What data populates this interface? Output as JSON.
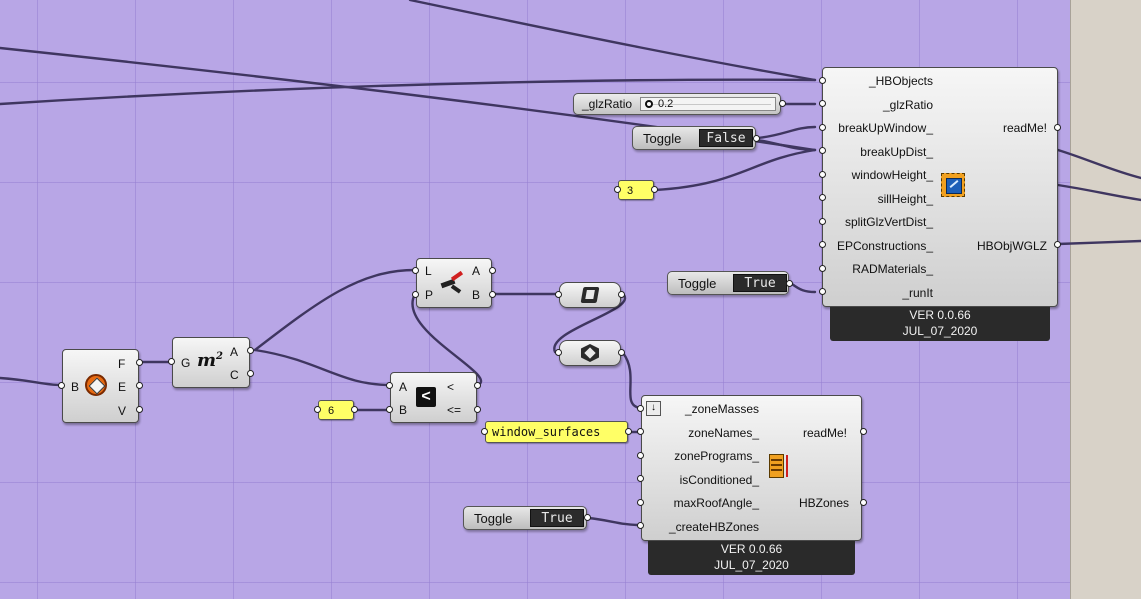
{
  "honeybee_glazing": {
    "inputs": [
      "_HBObjects",
      "_glzRatio",
      "breakUpWindow_",
      "breakUpDist_",
      "windowHeight_",
      "sillHeight_",
      "splitGlzVertDist_",
      "EPConstructions_",
      "RADMaterials_",
      "_runIt"
    ],
    "outputs": [
      "readMe!",
      "HBObjWGLZ"
    ],
    "version": "VER 0.0.66",
    "date": "JUL_07_2020"
  },
  "masses_to_zones": {
    "inputs": [
      "_zoneMasses",
      "zoneNames_",
      "zonePrograms_",
      "isConditioned_",
      "maxRoofAngle_",
      "_createHBZones"
    ],
    "outputs": [
      "readMe!",
      "HBZones"
    ],
    "version": "VER 0.0.66",
    "date": "JUL_07_2020"
  },
  "glz_slider": {
    "name": "_glzRatio",
    "value": "0.2",
    "fraction": 0.2
  },
  "toggles": {
    "break_up_window": {
      "label": "Toggle",
      "value": "False"
    },
    "run_it": {
      "label": "Toggle",
      "value": "True"
    },
    "create_zones": {
      "label": "Toggle",
      "value": "True"
    }
  },
  "panels": {
    "three": "3",
    "six": "6",
    "window_surfaces": "window_surfaces"
  },
  "brep_deconstruct": {
    "input": "B",
    "outputs": [
      "F",
      "E",
      "V"
    ]
  },
  "area": {
    "input": "G",
    "outputs": [
      "A",
      "C"
    ]
  },
  "dispatch": {
    "inputs": [
      "L",
      "P"
    ],
    "outputs": [
      "A",
      "B"
    ]
  },
  "smaller_than": {
    "inputs": [
      "A",
      "B"
    ],
    "outputs": [
      "<",
      "<="
    ]
  }
}
